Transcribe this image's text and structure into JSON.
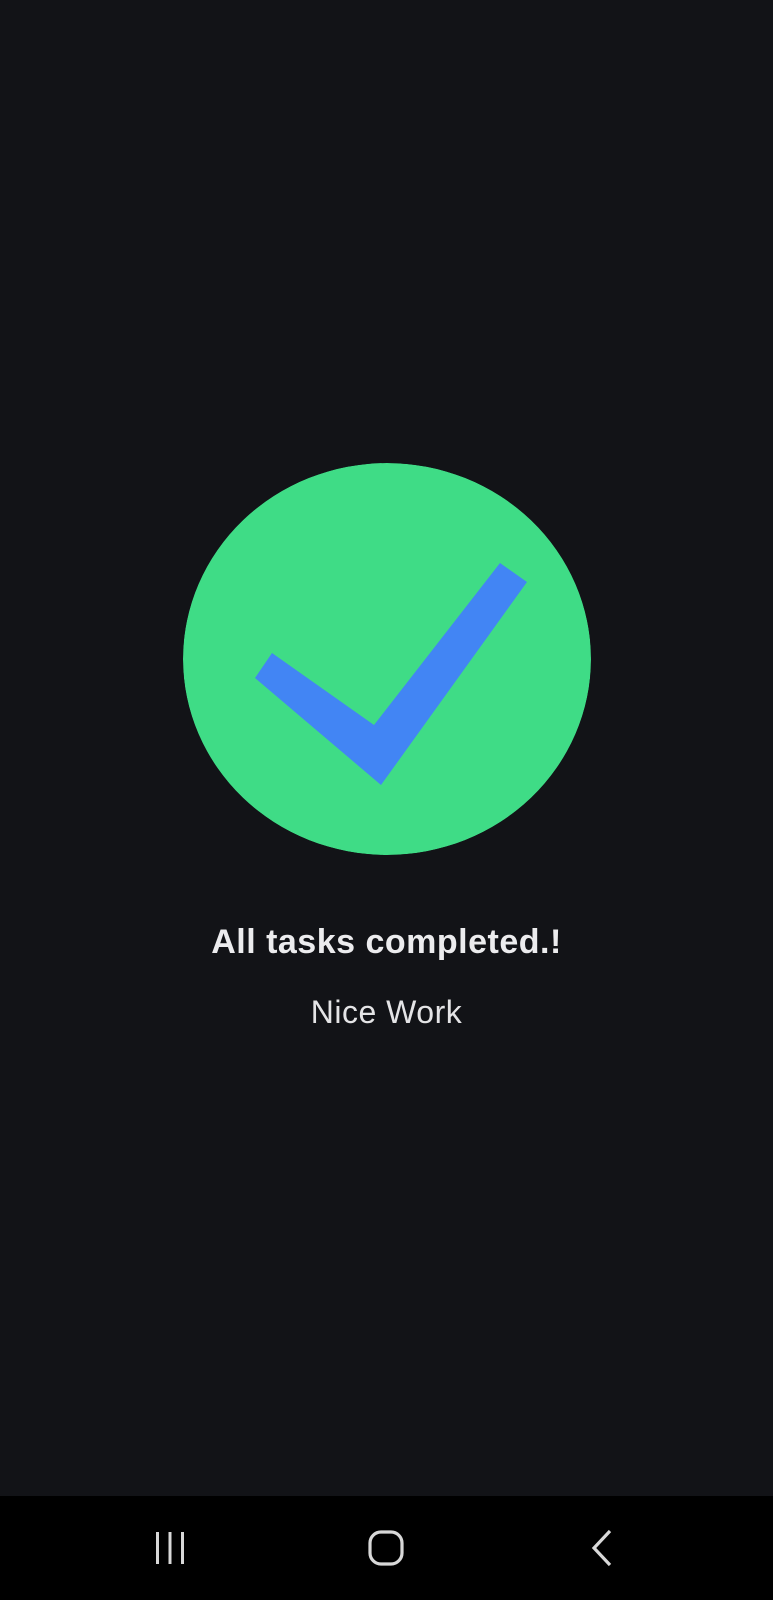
{
  "screen": {
    "background_color": "#121317"
  },
  "completion": {
    "icon": "check-icon",
    "circle_color": "#3FDC86",
    "check_color": "#4285F4",
    "title": "All tasks completed.!",
    "subtitle": "Nice Work"
  },
  "navigation_bar": {
    "background_color": "#000000",
    "buttons": [
      {
        "icon": "recent-apps-icon"
      },
      {
        "icon": "home-icon"
      },
      {
        "icon": "back-icon"
      }
    ]
  }
}
